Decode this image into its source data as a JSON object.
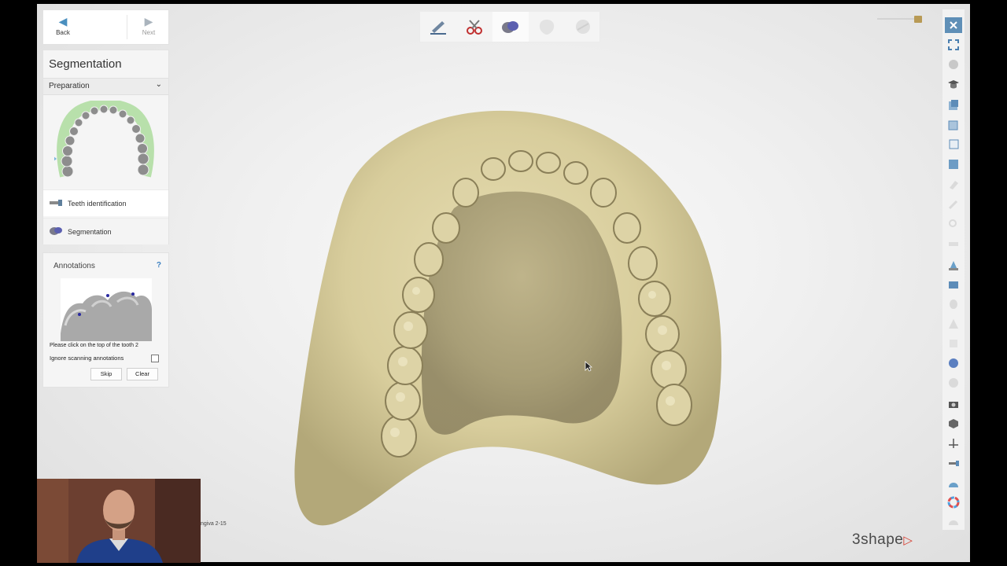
{
  "navigation": {
    "back_label": "Back",
    "next_label": "Next"
  },
  "segmentation_panel": {
    "title": "Segmentation",
    "dropdown_value": "Preparation",
    "steps": [
      {
        "label": "Teeth identification",
        "icon": "scanner-icon"
      },
      {
        "label": "Segmentation",
        "icon": "segmentation-icon"
      }
    ]
  },
  "annotations_panel": {
    "title": "Annotations",
    "help": "?",
    "instruction": "Please click on the top of the tooth 2",
    "ignore_label": "Ignore scanning annotations",
    "ignore_checked": false,
    "skip_label": "Skip",
    "clear_label": "Clear"
  },
  "top_toolbar": [
    "edit-icon",
    "scissors-icon",
    "segmentation-icon",
    "shield-icon",
    "sphere-icon"
  ],
  "status_text": "ngiva 2-15",
  "brand": {
    "name": "3shape",
    "accent": "#d63c2f"
  },
  "colors": {
    "model": "#d9cf9f",
    "accent_blue": "#4a8fbf"
  }
}
